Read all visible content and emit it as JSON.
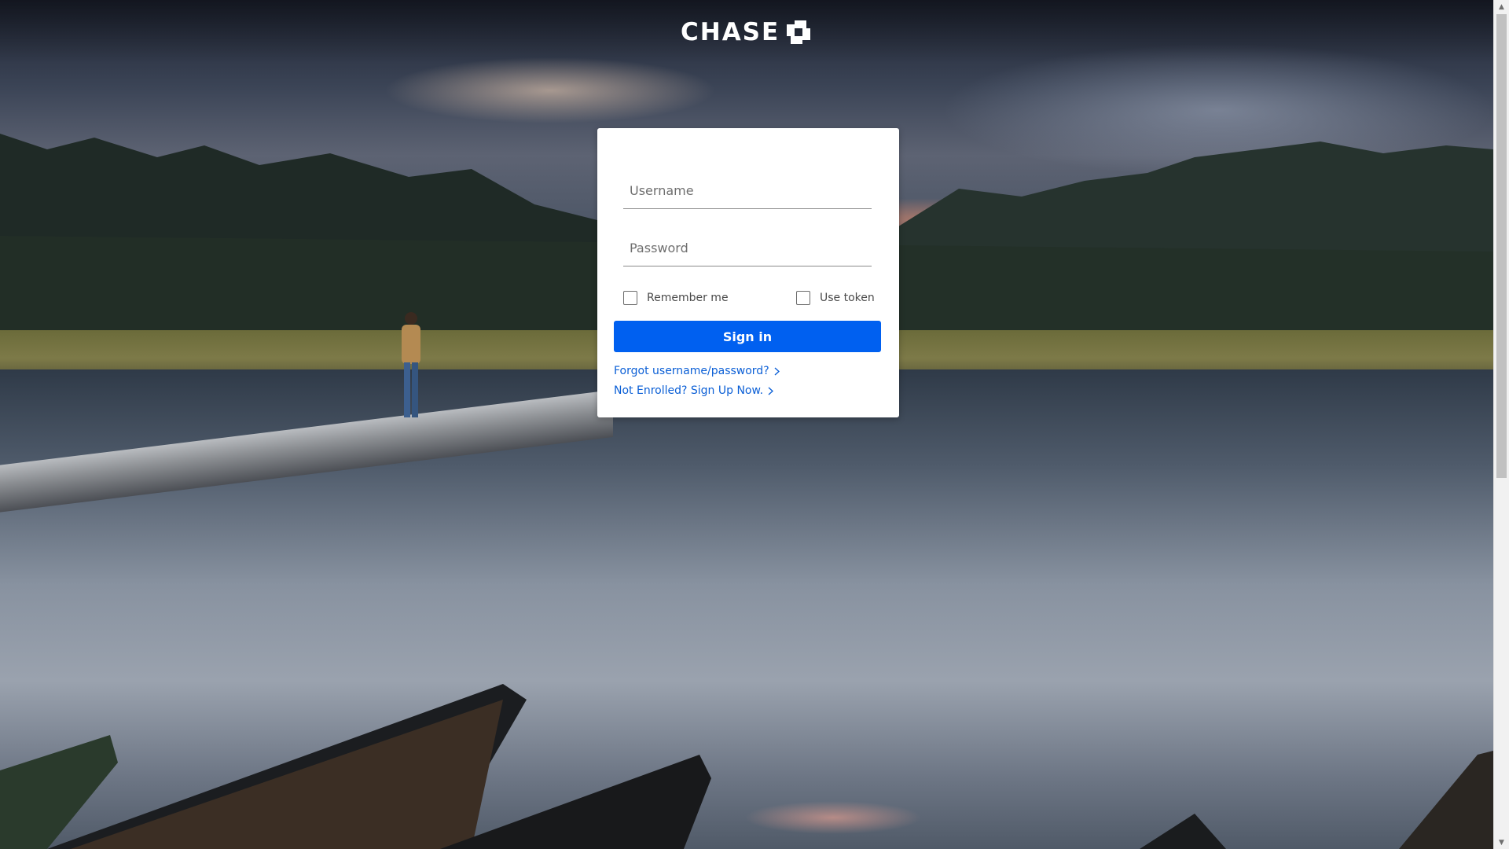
{
  "brand": {
    "name": "CHASE",
    "color": "#ffffff"
  },
  "login": {
    "username_placeholder": "Username",
    "password_placeholder": "Password",
    "remember_label": "Remember me",
    "token_label": "Use token",
    "signin_label": "Sign in",
    "forgot_link": "Forgot username/password?",
    "enroll_link": "Not Enrolled? Sign Up Now.",
    "accent_color": "#0060f0",
    "link_color": "#0b5fd6"
  },
  "icons": {
    "logo_mark": "chase-octagon-icon",
    "link_chevron": "chevron-right-icon",
    "scroll_up": "scroll-up-arrow-icon",
    "scroll_down": "scroll-down-arrow-icon"
  }
}
